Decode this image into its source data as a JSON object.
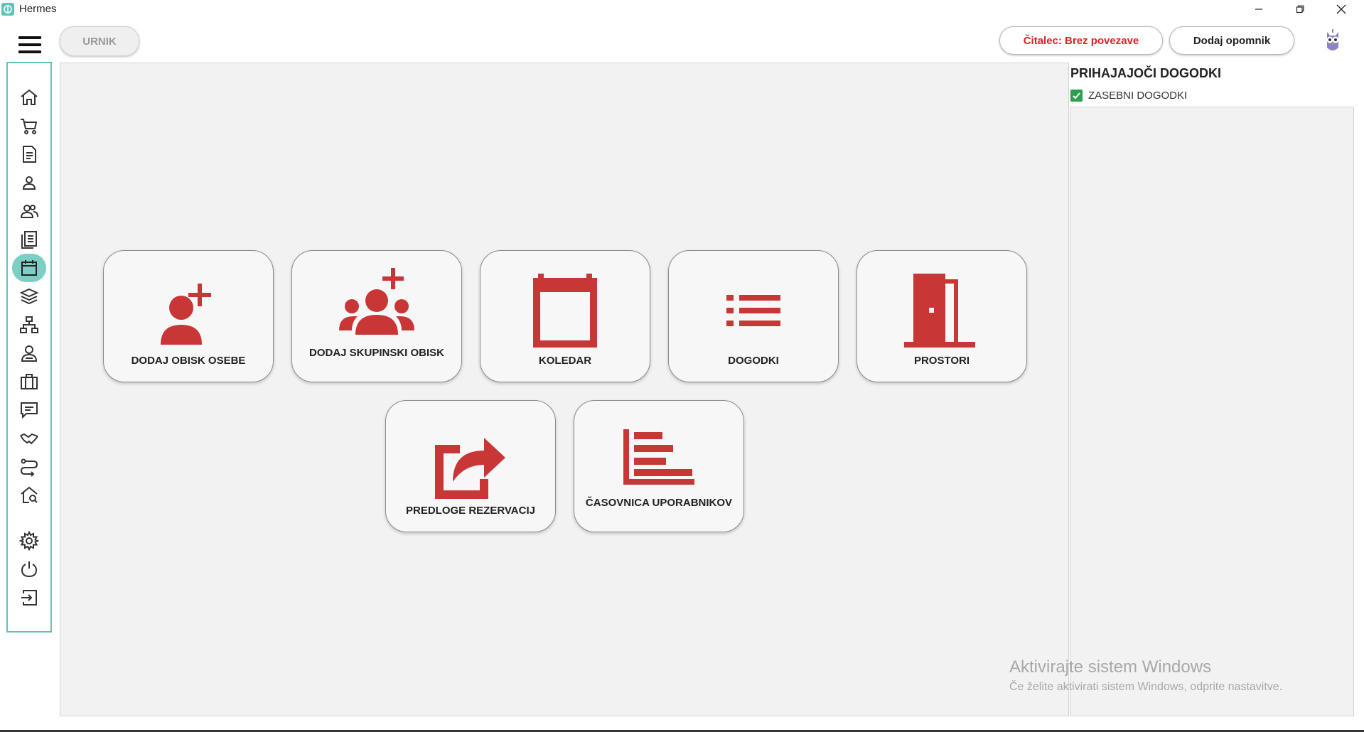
{
  "window": {
    "title": "Hermes",
    "controls": [
      "minimize",
      "restore",
      "close"
    ]
  },
  "header": {
    "urnik_label": "URNIK",
    "citalec_label": "Čitalec: Brez povezave",
    "dodaj_opomnik_label": "Dodaj opomnik"
  },
  "colors": {
    "accent": "#5fc4b8",
    "tile_icon": "#c93636",
    "alert_text": "#dd2222",
    "checkbox": "#2e9e4f"
  },
  "sidebar": {
    "items": [
      {
        "icon": "home-icon"
      },
      {
        "icon": "cart-icon"
      },
      {
        "icon": "document-icon"
      },
      {
        "icon": "person-icon"
      },
      {
        "icon": "group-icon"
      },
      {
        "icon": "list-document-icon"
      },
      {
        "icon": "calendar-icon",
        "active": true
      },
      {
        "icon": "layers-icon"
      },
      {
        "icon": "hierarchy-icon"
      },
      {
        "icon": "user-badge-icon"
      },
      {
        "icon": "briefcase-icon"
      },
      {
        "icon": "chat-icon"
      },
      {
        "icon": "handshake-icon"
      },
      {
        "icon": "route-icon"
      },
      {
        "icon": "home-search-icon"
      },
      {
        "icon": "gear-icon"
      },
      {
        "icon": "power-icon"
      },
      {
        "icon": "logout-icon"
      }
    ]
  },
  "tiles": [
    {
      "label": "DODAJ OBISK OSEBE",
      "icon": "add-person-icon"
    },
    {
      "label": "DODAJ SKUPINSKI OBISK",
      "icon": "add-group-icon"
    },
    {
      "label": "KOLEDAR",
      "icon": "calendar-icon"
    },
    {
      "label": "DOGODKI",
      "icon": "list-icon"
    },
    {
      "label": "PROSTORI",
      "icon": "door-icon"
    },
    {
      "label": "PREDLOGE REZERVACIJ",
      "icon": "share-icon"
    },
    {
      "label": "ČASOVNICA UPORABNIKOV",
      "icon": "timeline-icon"
    }
  ],
  "right_panel": {
    "title": "PRIHAJAJOČI DOGODKI",
    "checkbox_label": "ZASEBNI DOGODKI",
    "checkbox_checked": true
  },
  "watermark": {
    "line1": "Aktivirajte sistem Windows",
    "line2": "Če želite aktivirati sistem Windows, odprite nastavitve."
  }
}
